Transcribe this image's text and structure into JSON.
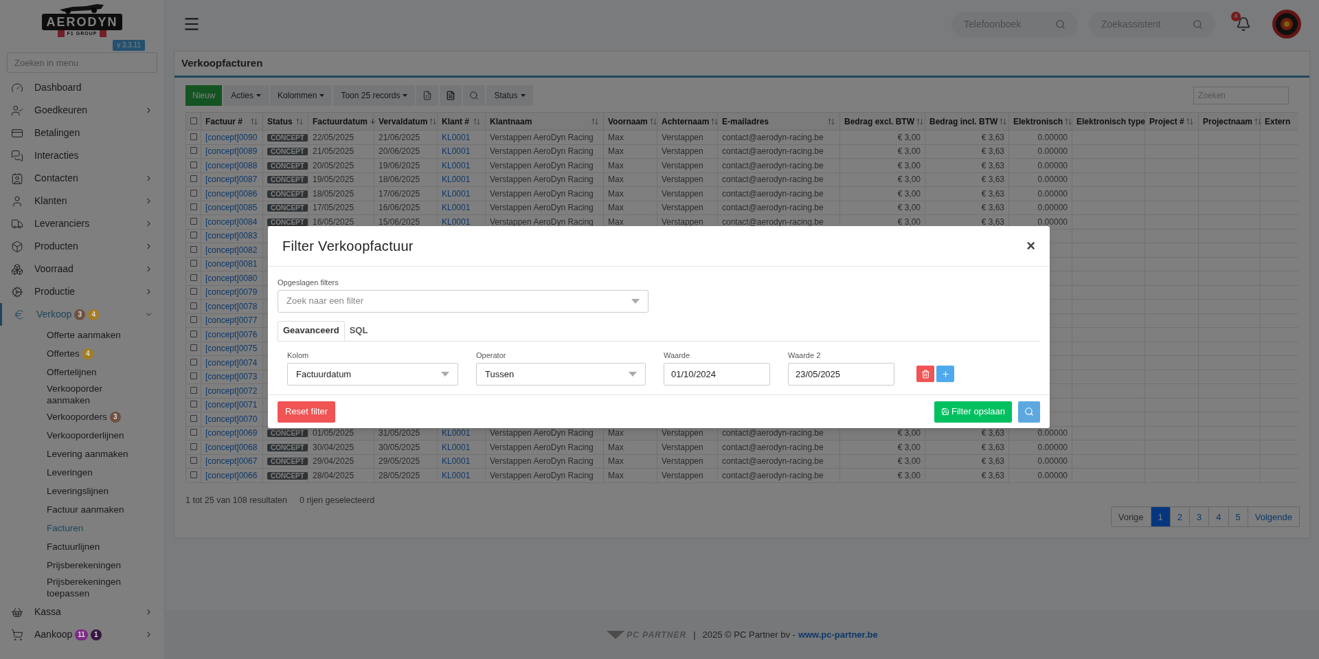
{
  "brand": {
    "name": "AERODYN",
    "tagline": "F1 GROUP",
    "version": "v 3.3.11"
  },
  "menu_search": {
    "placeholder": "Zoeken in menu"
  },
  "sidebar": {
    "items": [
      {
        "label": "Dashboard",
        "expandable": false,
        "expanded": false,
        "selected": false
      },
      {
        "label": "Goedkeuren",
        "expandable": true,
        "expanded": false,
        "selected": false
      },
      {
        "label": "Betalingen",
        "expandable": false,
        "expanded": false,
        "selected": false
      },
      {
        "label": "Interacties",
        "expandable": false,
        "expanded": false,
        "selected": false
      },
      {
        "label": "Contacten",
        "expandable": true,
        "expanded": false,
        "selected": false
      },
      {
        "label": "Klanten",
        "expandable": true,
        "expanded": false,
        "selected": false
      },
      {
        "label": "Leveranciers",
        "expandable": true,
        "expanded": false,
        "selected": false
      },
      {
        "label": "Producten",
        "expandable": true,
        "expanded": false,
        "selected": false
      },
      {
        "label": "Voorraad",
        "expandable": true,
        "expanded": false,
        "selected": false
      },
      {
        "label": "Productie",
        "expandable": true,
        "expanded": false,
        "selected": false
      },
      {
        "label": "Verkoop",
        "expandable": true,
        "expanded": true,
        "selected": true,
        "badges": [
          {
            "text": "3",
            "color": "#6e5142"
          },
          {
            "text": "4",
            "color": "#a57e1e"
          }
        ],
        "children": [
          {
            "label": "Offerte aanmaken",
            "selected": false
          },
          {
            "label": "Offertes",
            "selected": false,
            "badges": [
              {
                "text": "4",
                "color": "#a57e1e"
              }
            ]
          },
          {
            "label": "Offertelijnen",
            "selected": false
          },
          {
            "label": "Verkooporder aanmaken",
            "selected": false
          },
          {
            "label": "Verkooporders",
            "selected": false,
            "badges": [
              {
                "text": "3",
                "color": "#6e5142"
              }
            ]
          },
          {
            "label": "Verkooporderlijnen",
            "selected": false
          },
          {
            "label": "Levering aanmaken",
            "selected": false
          },
          {
            "label": "Leveringen",
            "selected": false
          },
          {
            "label": "Leveringslijnen",
            "selected": false
          },
          {
            "label": "Factuur aanmaken",
            "selected": false
          },
          {
            "label": "Facturen",
            "selected": true
          },
          {
            "label": "Factuurlijnen",
            "selected": false
          },
          {
            "label": "Prijsberekeningen",
            "selected": false
          },
          {
            "label": "Prijsberekeningen toepassen",
            "selected": false
          }
        ]
      },
      {
        "label": "Kassa",
        "expandable": true,
        "expanded": false,
        "selected": false
      },
      {
        "label": "Aankoop",
        "expandable": true,
        "expanded": false,
        "selected": false,
        "badges": [
          {
            "text": "11",
            "color": "#7d2b86"
          },
          {
            "text": "1",
            "color": "#35173f"
          }
        ]
      }
    ]
  },
  "topbar": {
    "phonebook": {
      "placeholder": "Telefoonboek"
    },
    "assistant": {
      "placeholder": "Zoekassistent"
    },
    "notifications": "4"
  },
  "card": {
    "title": "Verkoopfacturen",
    "toolbar": [
      {
        "kind": "primary",
        "label": "Nieuw"
      },
      {
        "kind": "dropdown",
        "label": "Acties"
      },
      {
        "kind": "dropdown",
        "label": "Kolommen"
      },
      {
        "kind": "dropdown",
        "label": "Toon 25 records"
      },
      {
        "kind": "icon"
      },
      {
        "kind": "icon"
      },
      {
        "kind": "icon"
      },
      {
        "kind": "dropdown",
        "label": "Status"
      }
    ],
    "search": {
      "placeholder": "Zoeken"
    },
    "select_all": {
      "checked": false
    },
    "columns": [
      {
        "label": "Factuur #",
        "sortable": true,
        "sorted": false
      },
      {
        "label": "Status",
        "sortable": true,
        "sorted": false
      },
      {
        "label": "Factuurdatum",
        "sortable": true,
        "sorted": true
      },
      {
        "label": "Vervaldatum",
        "sortable": true,
        "sorted": false
      },
      {
        "label": "Klant #",
        "sortable": true,
        "sorted": false
      },
      {
        "label": "Klantnaam",
        "sortable": true,
        "sorted": false
      },
      {
        "label": "Voornaam",
        "sortable": true,
        "sorted": false
      },
      {
        "label": "Achternaam",
        "sortable": true,
        "sorted": false
      },
      {
        "label": "E-mailadres",
        "sortable": true,
        "sorted": false
      },
      {
        "label": "Bedrag excl. BTW",
        "sortable": true,
        "sorted": false
      },
      {
        "label": "Bedrag incl. BTW",
        "sortable": true,
        "sorted": false
      },
      {
        "label": "Elektronisch",
        "sortable": true,
        "sorted": false
      },
      {
        "label": "Elektronisch type",
        "sortable": false
      },
      {
        "label": "Project #",
        "sortable": true,
        "sorted": false
      },
      {
        "label": "Projectnaam",
        "sortable": true,
        "sorted": false
      },
      {
        "label": "Extern",
        "sortable": false
      }
    ],
    "rows": [
      {
        "checked": false,
        "cells": [
          "[concept]0090",
          "CONCEPT",
          "22/05/2025",
          "21/06/2025",
          "KL0001",
          "Verstappen AeroDyn Racing",
          "Max",
          "Verstappen",
          "contact@aerodyn-racing.be",
          "€ 3,00",
          "€ 3,63",
          "0.00000"
        ]
      },
      {
        "checked": false,
        "cells": [
          "[concept]0089",
          "CONCEPT",
          "21/05/2025",
          "20/06/2025",
          "KL0001",
          "Verstappen AeroDyn Racing",
          "Max",
          "Verstappen",
          "contact@aerodyn-racing.be",
          "€ 3,00",
          "€ 3,63",
          "0.00000"
        ]
      },
      {
        "checked": false,
        "cells": [
          "[concept]0088",
          "CONCEPT",
          "20/05/2025",
          "19/06/2025",
          "KL0001",
          "Verstappen AeroDyn Racing",
          "Max",
          "Verstappen",
          "contact@aerodyn-racing.be",
          "€ 3,00",
          "€ 3,63",
          "0.00000"
        ]
      },
      {
        "checked": false,
        "cells": [
          "[concept]0087",
          "CONCEPT",
          "19/05/2025",
          "18/06/2025",
          "KL0001",
          "Verstappen AeroDyn Racing",
          "Max",
          "Verstappen",
          "contact@aerodyn-racing.be",
          "€ 3,00",
          "€ 3,63",
          "0.00000"
        ]
      },
      {
        "checked": false,
        "cells": [
          "[concept]0086",
          "CONCEPT",
          "18/05/2025",
          "17/06/2025",
          "KL0001",
          "Verstappen AeroDyn Racing",
          "Max",
          "Verstappen",
          "contact@aerodyn-racing.be",
          "€ 3,00",
          "€ 3,63",
          "0.00000"
        ]
      },
      {
        "checked": false,
        "cells": [
          "[concept]0085",
          "CONCEPT",
          "17/05/2025",
          "16/06/2025",
          "KL0001",
          "Verstappen AeroDyn Racing",
          "Max",
          "Verstappen",
          "contact@aerodyn-racing.be",
          "€ 3,00",
          "€ 3,63",
          "0.00000"
        ]
      },
      {
        "checked": false,
        "cells": [
          "[concept]0084",
          "CONCEPT",
          "16/05/2025",
          "15/06/2025",
          "KL0001",
          "Verstappen AeroDyn Racing",
          "Max",
          "Verstappen",
          "contact@aerodyn-racing.be",
          "€ 3,00",
          "€ 3,63",
          "0.00000"
        ]
      },
      {
        "checked": false,
        "cells": [
          "[concept]0083"
        ]
      },
      {
        "checked": false,
        "cells": [
          "[concept]0082"
        ]
      },
      {
        "checked": false,
        "cells": [
          "[concept]0081"
        ]
      },
      {
        "checked": false,
        "cells": [
          "[concept]0080"
        ]
      },
      {
        "checked": false,
        "cells": [
          "[concept]0079"
        ]
      },
      {
        "checked": false,
        "cells": [
          "[concept]0078"
        ]
      },
      {
        "checked": false,
        "cells": [
          "[concept]0077"
        ]
      },
      {
        "checked": false,
        "cells": [
          "[concept]0076"
        ]
      },
      {
        "checked": false,
        "cells": [
          "[concept]0075"
        ]
      },
      {
        "checked": false,
        "cells": [
          "[concept]0074"
        ]
      },
      {
        "checked": false,
        "cells": [
          "[concept]0073"
        ]
      },
      {
        "checked": false,
        "cells": [
          "[concept]0072"
        ]
      },
      {
        "checked": false,
        "cells": [
          "[concept]0071"
        ]
      },
      {
        "checked": false,
        "cells": [
          "[concept]0070"
        ]
      },
      {
        "checked": false,
        "cells": [
          "[concept]0069",
          "CONCEPT",
          "01/05/2025",
          "31/05/2025",
          "KL0001",
          "Verstappen AeroDyn Racing",
          "Max",
          "Verstappen",
          "contact@aerodyn-racing.be",
          "€ 3,00",
          "€ 3,63",
          "0.00000"
        ]
      },
      {
        "checked": false,
        "cells": [
          "[concept]0068",
          "CONCEPT",
          "30/04/2025",
          "30/05/2025",
          "KL0001",
          "Verstappen AeroDyn Racing",
          "Max",
          "Verstappen",
          "contact@aerodyn-racing.be",
          "€ 3,00",
          "€ 3,63",
          "0.00000"
        ]
      },
      {
        "checked": false,
        "cells": [
          "[concept]0067",
          "CONCEPT",
          "29/04/2025",
          "29/05/2025",
          "KL0001",
          "Verstappen AeroDyn Racing",
          "Max",
          "Verstappen",
          "contact@aerodyn-racing.be",
          "€ 3,00",
          "€ 3,63",
          "0.00000"
        ]
      },
      {
        "checked": false,
        "cells": [
          "[concept]0066",
          "CONCEPT",
          "28/04/2025",
          "28/05/2025",
          "KL0001",
          "Verstappen AeroDyn Racing",
          "Max",
          "Verstappen",
          "contact@aerodyn-racing.be",
          "€ 3,00",
          "€ 3,63",
          "0.00000"
        ]
      }
    ],
    "summary": [
      "1 tot 25 van 108 resultaten",
      "0 rijen geselecteerd"
    ],
    "pagination": [
      {
        "label": "Vorige",
        "selected": false
      },
      {
        "label": "1",
        "selected": true
      },
      {
        "label": "2",
        "selected": false
      },
      {
        "label": "3",
        "selected": false
      },
      {
        "label": "4",
        "selected": false
      },
      {
        "label": "5",
        "selected": false
      },
      {
        "label": "Volgende",
        "selected": false
      }
    ]
  },
  "footer": {
    "logo": "PC PARTNER",
    "separator": "|",
    "text": "2025 © PC Partner bv -",
    "link": "www.pc-partner.be"
  },
  "modal": {
    "title": "Filter Verkoopfactuur",
    "close": "×",
    "saved_filters": {
      "label": "Opgeslagen filters",
      "placeholder": "Zoek naar een filter"
    },
    "tabs": [
      {
        "label": "Geavanceerd",
        "selected": true
      },
      {
        "label": "SQL",
        "selected": false
      }
    ],
    "fields": [
      {
        "kind": "select",
        "label": "Kolom",
        "value": "Factuurdatum"
      },
      {
        "kind": "select",
        "label": "Operator",
        "value": "Tussen"
      },
      {
        "kind": "input",
        "label": "Waarde",
        "value": "01/10/2024"
      },
      {
        "kind": "input",
        "label": "Waarde 2",
        "value": "23/05/2025"
      }
    ],
    "reset": "Reset filter",
    "save": "Filter opslaan"
  }
}
